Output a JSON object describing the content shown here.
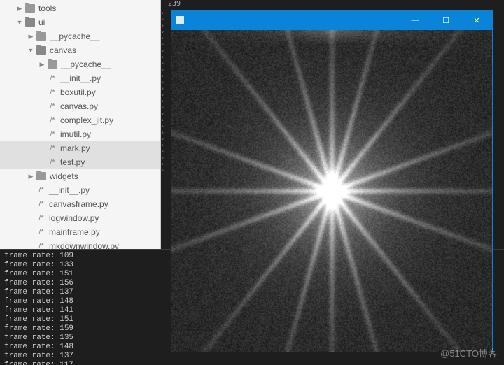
{
  "tree": [
    {
      "depth": 1,
      "kind": "folder",
      "state": "closed",
      "label": "tools"
    },
    {
      "depth": 1,
      "kind": "folder",
      "state": "open",
      "label": "ui"
    },
    {
      "depth": 2,
      "kind": "folder",
      "state": "closed",
      "label": "__pycache__"
    },
    {
      "depth": 2,
      "kind": "folder",
      "state": "open",
      "label": "canvas"
    },
    {
      "depth": 3,
      "kind": "folder",
      "state": "closed",
      "label": "__pycache__"
    },
    {
      "depth": 3,
      "kind": "file",
      "label": "__init__.py"
    },
    {
      "depth": 3,
      "kind": "file",
      "label": "boxutil.py"
    },
    {
      "depth": 3,
      "kind": "file",
      "label": "canvas.py"
    },
    {
      "depth": 3,
      "kind": "file",
      "label": "complex_jit.py"
    },
    {
      "depth": 3,
      "kind": "file",
      "label": "imutil.py"
    },
    {
      "depth": 3,
      "kind": "file",
      "label": "mark.py",
      "selected": true
    },
    {
      "depth": 3,
      "kind": "file",
      "label": "test.py",
      "selected": true
    },
    {
      "depth": 2,
      "kind": "folder",
      "state": "closed",
      "label": "widgets"
    },
    {
      "depth": 2,
      "kind": "file",
      "label": "__init__.py"
    },
    {
      "depth": 2,
      "kind": "file",
      "label": "canvasframe.py"
    },
    {
      "depth": 2,
      "kind": "file",
      "label": "logwindow.py"
    },
    {
      "depth": 2,
      "kind": "file",
      "label": "mainframe.py"
    },
    {
      "depth": 2,
      "kind": "file",
      "label": "mkdownwindow.py"
    }
  ],
  "ruler": {
    "top_number": "239"
  },
  "image_window": {
    "minimize": "—",
    "maximize": "☐",
    "close": "✕"
  },
  "terminal": {
    "prefix": "frame rate: ",
    "lines": [
      "frame rate: 109",
      "frame rate: 133",
      "frame rate: 151",
      "frame rate: 156",
      "frame rate: 137",
      "frame rate: 148",
      "frame rate: 141",
      "frame rate: 151",
      "frame rate: 159",
      "frame rate: 135",
      "frame rate: 148",
      "frame rate: 137",
      "frame rate: 117"
    ]
  },
  "watermark": "@51CTO博客",
  "colors": {
    "accent": "#0a84d8",
    "sidebar_bg": "#f5f5f5",
    "dark_bg": "#1e1e1e"
  }
}
